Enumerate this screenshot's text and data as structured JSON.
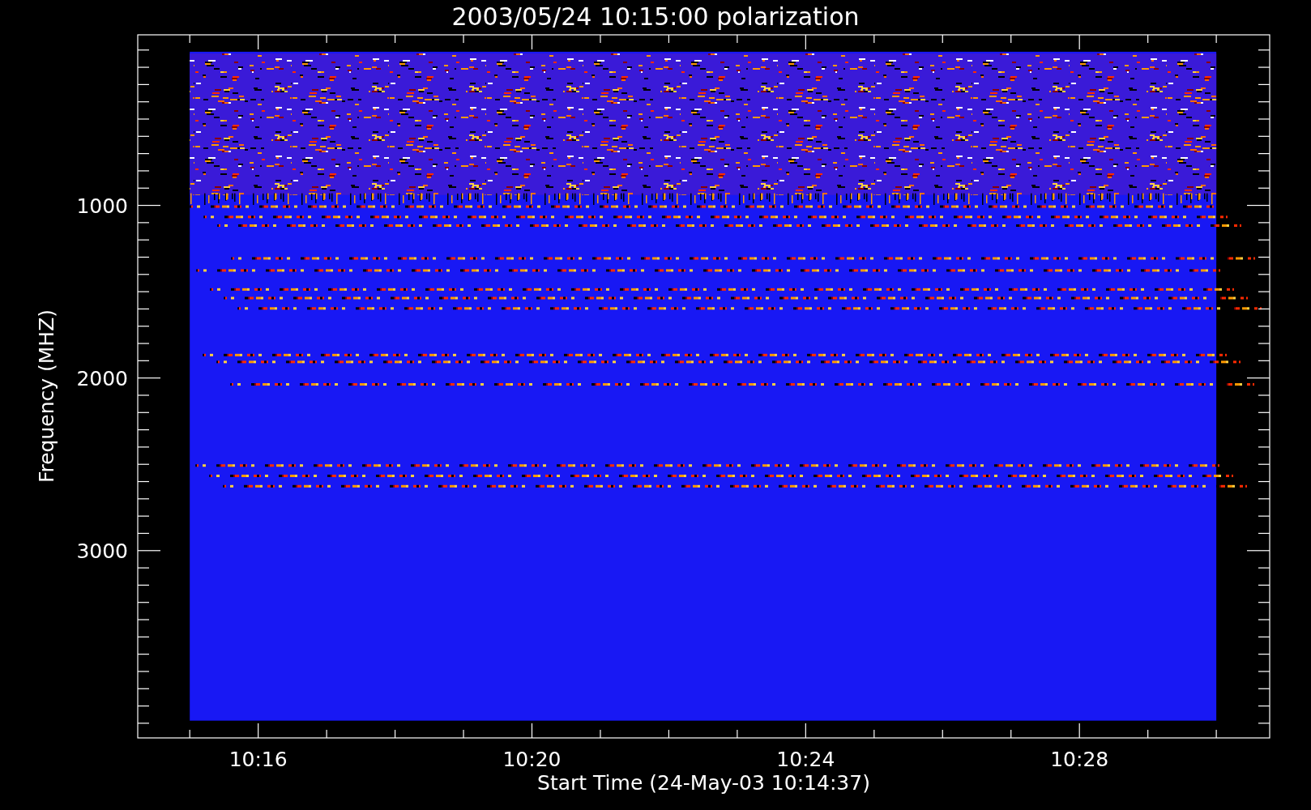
{
  "plot": {
    "title": "2003/05/24 10:15:00 polarization",
    "xlabel": "Start Time (24-May-03 10:14:37)",
    "ylabel": "Frequency (MHZ)",
    "xticks": [
      "10:16",
      "10:20",
      "10:24",
      "10:28"
    ],
    "yticks": [
      "1000",
      "2000",
      "3000"
    ]
  }
}
